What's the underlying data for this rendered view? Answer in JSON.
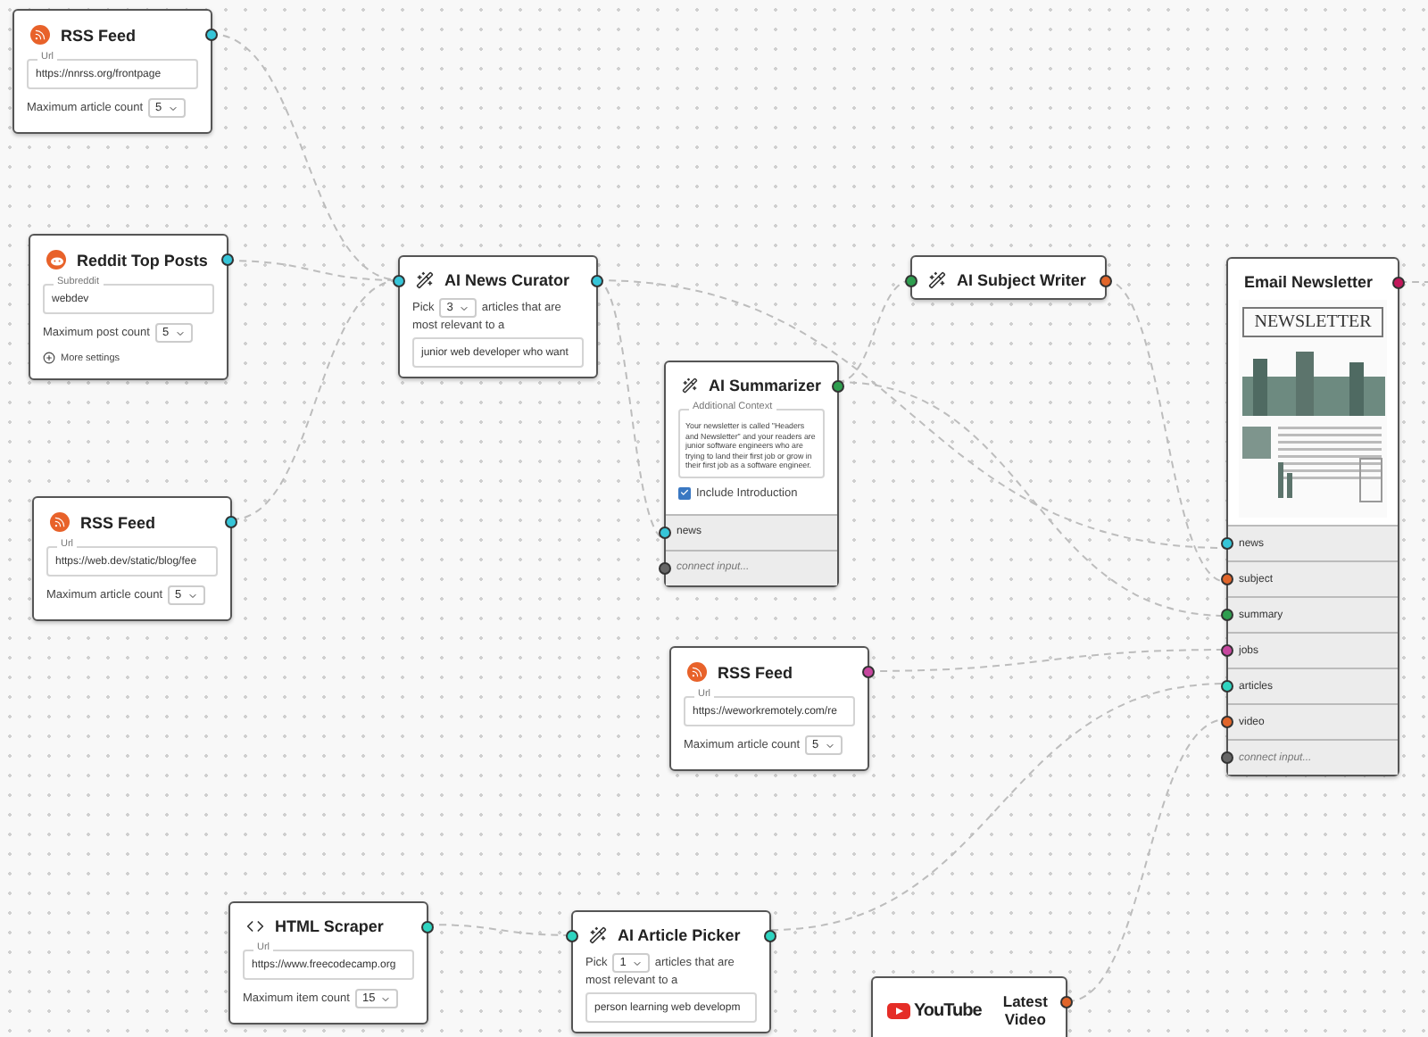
{
  "nodes": [
    {
      "kind": "rss",
      "title": "RSS Feed",
      "url_label": "Url",
      "url": "https://nnrss.org/frontpage",
      "count_label": "Maximum article count",
      "count": "5",
      "output": {
        "color": "#36c5d8"
      }
    },
    {
      "kind": "reddit",
      "title": "Reddit Top Posts",
      "url_label": "Subreddit",
      "url": "webdev",
      "count_label": "Maximum post count",
      "count": "5",
      "more": "More settings",
      "output": {
        "color": "#36c5d8"
      }
    },
    {
      "kind": "rss",
      "title": "RSS Feed",
      "url_label": "Url",
      "url": "https://web.dev/static/blog/fee",
      "count_label": "Maximum article count",
      "count": "5",
      "output": {
        "color": "#36c5d8"
      }
    },
    {
      "kind": "picker",
      "title": "AI News Curator",
      "pick": "Pick",
      "count": "3",
      "after": "articles that are",
      "line2": "most relevant to a",
      "audience": "junior web developer who want",
      "input": {
        "color": "#36c5d8"
      },
      "output": {
        "color": "#36c5d8"
      }
    },
    {
      "kind": "summarizer",
      "title": "AI Summarizer",
      "context_label": "Additional Context",
      "context": "Your newsletter is called \"Headers and Newsletter\" and your readers are junior software engineers who are trying to land their first job or grow in their first job as a software engineer.",
      "checkbox_label": "Include Introduction",
      "checked": true,
      "output": {
        "color": "#2e9e4f"
      },
      "inputs": [
        {
          "label": "news",
          "color": "#36c5d8",
          "kind": "port"
        },
        {
          "label": "connect input...",
          "color": "#666666",
          "kind": "empty"
        }
      ]
    },
    {
      "kind": "subject",
      "title": "AI Subject Writer",
      "input": {
        "color": "#2e9e4f"
      },
      "output": {
        "color": "#e0652a"
      }
    },
    {
      "kind": "newsletter",
      "title": "Email Newsletter",
      "image_text": "NEWSLETTER",
      "output": {
        "color": "#c2185b"
      },
      "inputs": [
        {
          "label": "news",
          "color": "#36c5d8",
          "kind": "port"
        },
        {
          "label": "subject",
          "color": "#e0652a",
          "kind": "port"
        },
        {
          "label": "summary",
          "color": "#2e9e4f",
          "kind": "port"
        },
        {
          "label": "jobs",
          "color": "#c7479f",
          "kind": "port"
        },
        {
          "label": "articles",
          "color": "#2ed4c0",
          "kind": "port"
        },
        {
          "label": "video",
          "color": "#e0652a",
          "kind": "port"
        },
        {
          "label": "connect input...",
          "color": "#666666",
          "kind": "empty"
        }
      ]
    },
    {
      "kind": "rss",
      "title": "RSS Feed",
      "url_label": "Url",
      "url": "https://weworkremotely.com/re",
      "count_label": "Maximum article count",
      "count": "5",
      "output": {
        "color": "#c7479f"
      }
    },
    {
      "kind": "scraper",
      "title": "HTML Scraper",
      "url_label": "Url",
      "url": "https://www.freecodecamp.org",
      "count_label": "Maximum item count",
      "count": "15",
      "output": {
        "color": "#2ed4c0"
      }
    },
    {
      "kind": "picker",
      "title": "AI Article Picker",
      "pick": "Pick",
      "count": "1",
      "after": "articles that are",
      "line2": "most relevant to a",
      "audience": "person learning web developm",
      "input": {
        "color": "#2ed4c0"
      },
      "output": {
        "color": "#2ed4c0"
      }
    },
    {
      "kind": "youtube",
      "title": "Latest Video",
      "logo": "YouTube",
      "output": {
        "color": "#e0652a"
      }
    }
  ]
}
